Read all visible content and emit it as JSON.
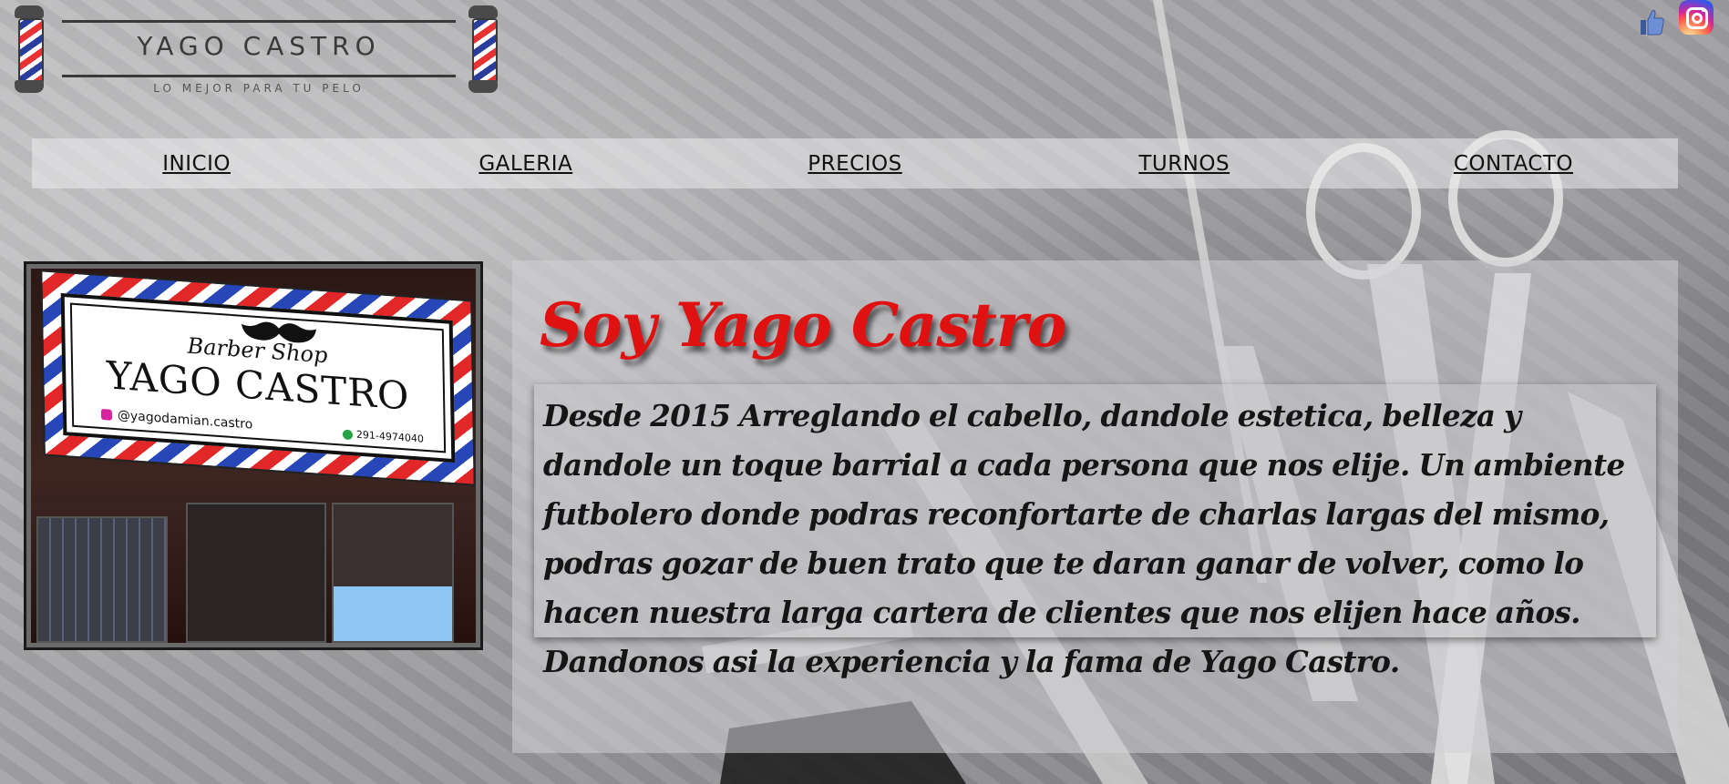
{
  "logo": {
    "title": "YAGO CASTRO",
    "subtitle": "LO MEJOR PARA TU PELO"
  },
  "social": {
    "icons": [
      "like-icon",
      "instagram-icon"
    ]
  },
  "nav": {
    "items": [
      "INICIO",
      "GALERIA",
      "PRECIOS",
      "TURNOS",
      "CONTACTO"
    ]
  },
  "photo": {
    "sign_script": "Barber Shop",
    "sign_name": "YAGO CASTRO",
    "sign_instagram": "@yagodamian.castro",
    "sign_phone": "291-4974040"
  },
  "about": {
    "heading": "Soy Yago Castro",
    "body": "Desde 2015 Arreglando el cabello, dandole estetica, belleza y dandole un toque barrial a cada persona que nos elije. Un ambiente futbolero donde podras reconfortarte de charlas largas del mismo, podras gozar de buen trato que te daran ganar de volver, como lo hacen nuestra larga cartera de clientes que nos elijen hace años. Dandonos asi la experiencia y la fama de Yago Castro."
  },
  "colors": {
    "heading_red": "#e01111",
    "pole_red": "#e63232",
    "pole_blue": "#2a3c9c"
  }
}
